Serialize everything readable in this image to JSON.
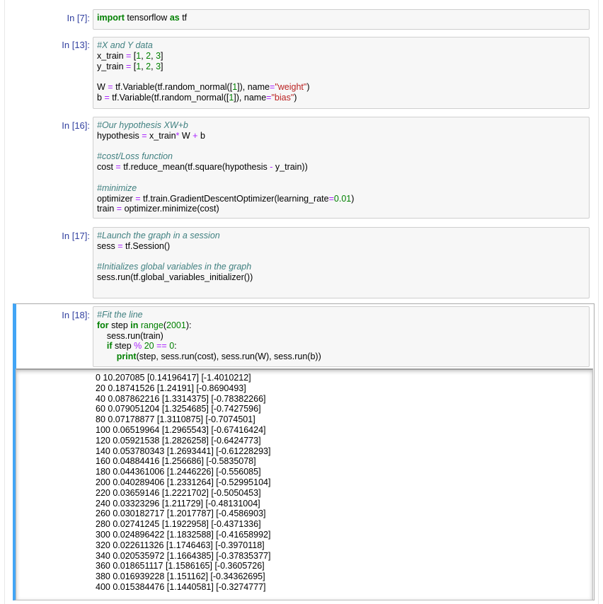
{
  "cells": [
    {
      "prompt": "In [7]:",
      "lines": [
        [
          {
            "t": "kw",
            "v": "import"
          },
          {
            "t": "",
            "v": " tensorflow "
          },
          {
            "t": "kw",
            "v": "as"
          },
          {
            "t": "",
            "v": " tf"
          }
        ]
      ]
    },
    {
      "prompt": "In [13]:",
      "lines": [
        [
          {
            "t": "cm",
            "v": "#X and Y data"
          }
        ],
        [
          {
            "t": "",
            "v": "x_train "
          },
          {
            "t": "op",
            "v": "="
          },
          {
            "t": "",
            "v": " ["
          },
          {
            "t": "nm",
            "v": "1"
          },
          {
            "t": "",
            "v": ", "
          },
          {
            "t": "nm",
            "v": "2"
          },
          {
            "t": "",
            "v": ", "
          },
          {
            "t": "nm",
            "v": "3"
          },
          {
            "t": "",
            "v": "]"
          }
        ],
        [
          {
            "t": "",
            "v": "y_train "
          },
          {
            "t": "op",
            "v": "="
          },
          {
            "t": "",
            "v": " ["
          },
          {
            "t": "nm",
            "v": "1"
          },
          {
            "t": "",
            "v": ", "
          },
          {
            "t": "nm",
            "v": "2"
          },
          {
            "t": "",
            "v": ", "
          },
          {
            "t": "nm",
            "v": "3"
          },
          {
            "t": "",
            "v": "]"
          }
        ],
        [
          {
            "t": "",
            "v": ""
          }
        ],
        [
          {
            "t": "",
            "v": "W "
          },
          {
            "t": "op",
            "v": "="
          },
          {
            "t": "",
            "v": " tf.Variable(tf.random_normal(["
          },
          {
            "t": "nm",
            "v": "1"
          },
          {
            "t": "",
            "v": "]), name"
          },
          {
            "t": "op",
            "v": "="
          },
          {
            "t": "st",
            "v": "\"weight\""
          },
          {
            "t": "",
            "v": ")"
          }
        ],
        [
          {
            "t": "",
            "v": "b "
          },
          {
            "t": "op",
            "v": "="
          },
          {
            "t": "",
            "v": " tf.Variable(tf.random_normal(["
          },
          {
            "t": "nm",
            "v": "1"
          },
          {
            "t": "",
            "v": "]), name"
          },
          {
            "t": "op",
            "v": "="
          },
          {
            "t": "st",
            "v": "\"bias\""
          },
          {
            "t": "",
            "v": ")"
          }
        ]
      ]
    },
    {
      "prompt": "In [16]:",
      "lines": [
        [
          {
            "t": "cm",
            "v": "#Our hypothesis XW+b"
          }
        ],
        [
          {
            "t": "",
            "v": "hypothesis "
          },
          {
            "t": "op",
            "v": "="
          },
          {
            "t": "",
            "v": " x_train"
          },
          {
            "t": "op",
            "v": "*"
          },
          {
            "t": "",
            "v": " W "
          },
          {
            "t": "op",
            "v": "+"
          },
          {
            "t": "",
            "v": " b"
          }
        ],
        [
          {
            "t": "",
            "v": ""
          }
        ],
        [
          {
            "t": "cm",
            "v": "#cost/Loss function"
          }
        ],
        [
          {
            "t": "",
            "v": "cost "
          },
          {
            "t": "op",
            "v": "="
          },
          {
            "t": "",
            "v": " tf.reduce_mean(tf.square(hypothesis "
          },
          {
            "t": "op",
            "v": "-"
          },
          {
            "t": "",
            "v": " y_train))"
          }
        ],
        [
          {
            "t": "",
            "v": ""
          }
        ],
        [
          {
            "t": "cm",
            "v": "#minimize"
          }
        ],
        [
          {
            "t": "",
            "v": "optimizer "
          },
          {
            "t": "op",
            "v": "="
          },
          {
            "t": "",
            "v": " tf.train.GradientDescentOptimizer(learning_rate"
          },
          {
            "t": "op",
            "v": "="
          },
          {
            "t": "nm",
            "v": "0.01"
          },
          {
            "t": "",
            "v": ")"
          }
        ],
        [
          {
            "t": "",
            "v": "train "
          },
          {
            "t": "op",
            "v": "="
          },
          {
            "t": "",
            "v": " optimizer.minimize(cost)"
          }
        ]
      ]
    },
    {
      "prompt": "In [17]:",
      "lines": [
        [
          {
            "t": "cm",
            "v": "#Launch the graph in a session"
          }
        ],
        [
          {
            "t": "",
            "v": "sess "
          },
          {
            "t": "op",
            "v": "="
          },
          {
            "t": "",
            "v": " tf.Session()"
          }
        ],
        [
          {
            "t": "",
            "v": ""
          }
        ],
        [
          {
            "t": "cm",
            "v": "#Initializes global variables in the graph"
          }
        ],
        [
          {
            "t": "",
            "v": "sess.run(tf.global_variables_initializer())"
          }
        ],
        [
          {
            "t": "",
            "v": ""
          }
        ]
      ]
    },
    {
      "prompt": "In [18]:",
      "lines": [
        [
          {
            "t": "cm",
            "v": "#Fit the line"
          }
        ],
        [
          {
            "t": "kw",
            "v": "for"
          },
          {
            "t": "",
            "v": " step "
          },
          {
            "t": "kw",
            "v": "in"
          },
          {
            "t": "",
            "v": " "
          },
          {
            "t": "nm",
            "v": "range"
          },
          {
            "t": "",
            "v": "("
          },
          {
            "t": "nm",
            "v": "2001"
          },
          {
            "t": "",
            "v": "):"
          }
        ],
        [
          {
            "t": "",
            "v": "    sess.run(train)"
          }
        ],
        [
          {
            "t": "",
            "v": "    "
          },
          {
            "t": "kw",
            "v": "if"
          },
          {
            "t": "",
            "v": " step "
          },
          {
            "t": "op",
            "v": "%"
          },
          {
            "t": "",
            "v": " "
          },
          {
            "t": "nm",
            "v": "20"
          },
          {
            "t": "",
            "v": " "
          },
          {
            "t": "op",
            "v": "=="
          },
          {
            "t": "",
            "v": " "
          },
          {
            "t": "nm",
            "v": "0"
          },
          {
            "t": "",
            "v": ":"
          }
        ],
        [
          {
            "t": "",
            "v": "        "
          },
          {
            "t": "kw",
            "v": "print"
          },
          {
            "t": "",
            "v": "(step, sess.run(cost), sess.run(W), sess.run(b))"
          }
        ]
      ]
    }
  ],
  "output": [
    "0 10.207085 [0.14196417] [-1.4010212]",
    "20 0.18741526 [1.24191] [-0.8690493]",
    "40 0.087862216 [1.3314375] [-0.78382266]",
    "60 0.079051204 [1.3254685] [-0.7427596]",
    "80 0.07178877 [1.3110875] [-0.7074501]",
    "100 0.06519964 [1.2965543] [-0.67416424]",
    "120 0.05921538 [1.2826258] [-0.6424773]",
    "140 0.053780343 [1.2693441] [-0.61228293]",
    "160 0.04884416 [1.256686] [-0.5835078]",
    "180 0.044361006 [1.2446226] [-0.556085]",
    "200 0.040289406 [1.2331264] [-0.52995104]",
    "220 0.03659146 [1.2221702] [-0.5050453]",
    "240 0.03323296 [1.211729] [-0.48131004]",
    "260 0.030182717 [1.2017787] [-0.4586903]",
    "280 0.02741245 [1.1922958] [-0.4371336]",
    "300 0.024896422 [1.1832588] [-0.41658992]",
    "320 0.022611326 [1.1746463] [-0.3970118]",
    "340 0.020535972 [1.1664385] [-0.37835377]",
    "360 0.018651117 [1.1586165] [-0.3605726]",
    "380 0.016939228 [1.151162] [-0.34362695]",
    "400 0.015384476 [1.1440581] [-0.3274777]"
  ]
}
